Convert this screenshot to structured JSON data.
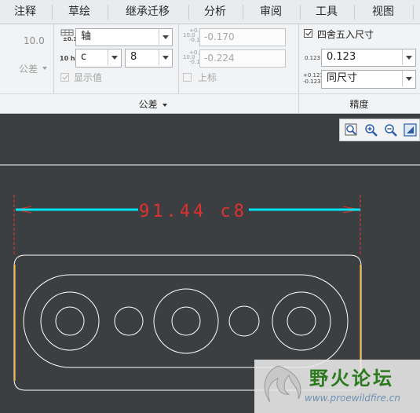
{
  "tabs": [
    "注释",
    "草绘",
    "继承迁移",
    "分析",
    "审阅",
    "工具",
    "视图"
  ],
  "tolerance": {
    "preview_value": "10.0",
    "format_label": "公差",
    "fit_icon_value": "±0.1",
    "hole_shaft_label": "10 h7",
    "hole_shaft_value": "轴",
    "fit_letter_value": "c",
    "grade_value": "8",
    "show_value_label": "显示值",
    "upper_value": "-0.170",
    "lower_value": "-0.224",
    "superscript_label": "上标",
    "group_label": "公差"
  },
  "precision": {
    "round_label": "四舍五入尺寸",
    "decimals_icon": "0.123",
    "decimals_value": "0.123",
    "tol_decimals_value": "同尺寸",
    "group_label": "精度"
  },
  "drawing": {
    "dimension_text": "91.44 c8",
    "dimension_color": "#e0312f",
    "leader_color": "#00e5f0",
    "geometry_color": "#ffffff",
    "highlight_edge_color": "#e8a317"
  },
  "watermark": {
    "title": "野火论坛",
    "url": "www.proewildfire.cn"
  }
}
